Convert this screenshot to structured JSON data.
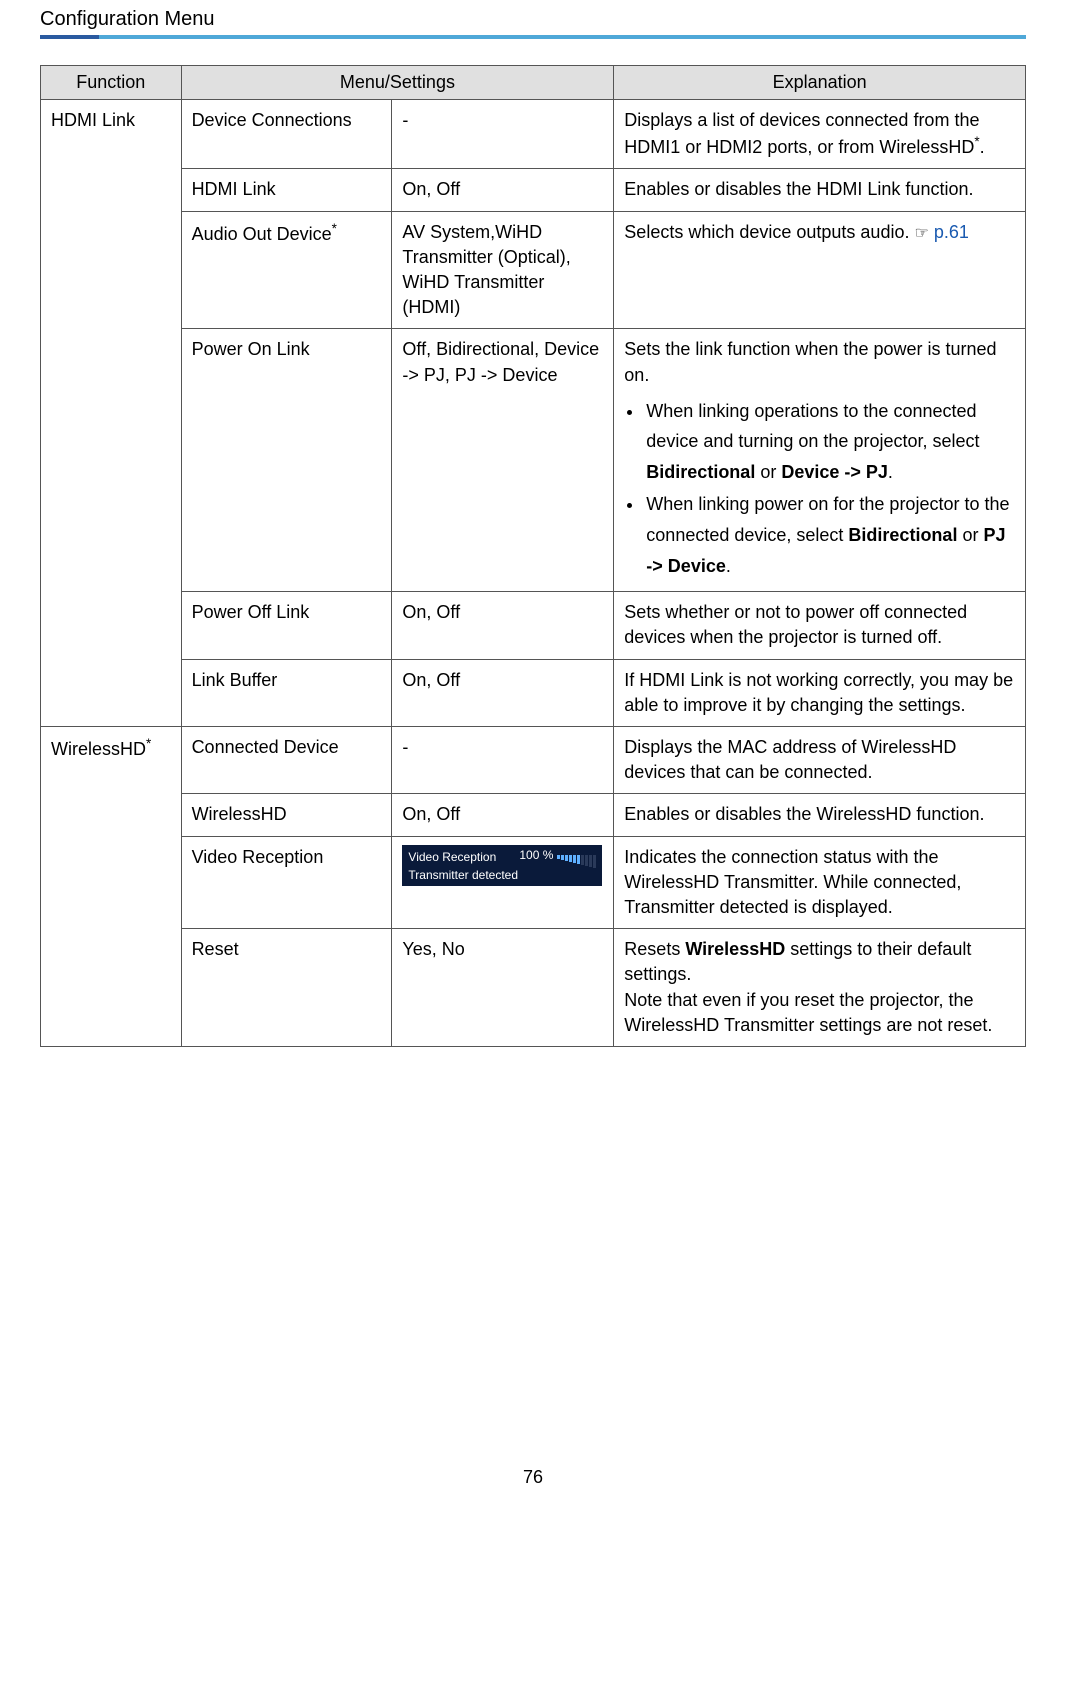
{
  "page_title": "Configuration Menu",
  "page_number": "76",
  "headers": {
    "function": "Function",
    "menu_settings": "Menu/Settings",
    "explanation": "Explanation"
  },
  "groups": [
    {
      "function": "HDMI Link",
      "function_sup": "",
      "rows": [
        {
          "menu": "Device Connections",
          "menu_sup": "",
          "settings": "-",
          "explanation_parts": [
            {
              "t": "text",
              "v": "Displays a list of devices connected from the HDMI1 or HDMI2 ports, or from WirelessHD"
            },
            {
              "t": "sup",
              "v": "*"
            },
            {
              "t": "text",
              "v": "."
            }
          ]
        },
        {
          "menu": "HDMI Link",
          "menu_sup": "",
          "settings": "On, Off",
          "explanation_parts": [
            {
              "t": "text",
              "v": "Enables or disables the HDMI Link function."
            }
          ]
        },
        {
          "menu": "Audio Out Device",
          "menu_sup": "*",
          "settings": "AV System,WiHD Transmitter (Optical), WiHD Transmitter (HDMI)",
          "explanation_parts": [
            {
              "t": "text",
              "v": "Selects which device outputs audio. "
            },
            {
              "t": "pointer",
              "v": "☞"
            },
            {
              "t": "space",
              "v": "  "
            },
            {
              "t": "link",
              "v": "p.61"
            }
          ]
        },
        {
          "menu": "Power On Link",
          "menu_sup": "",
          "settings": "Off, Bidirectional, Device -> PJ, PJ -> Device",
          "explanation_parts": [
            {
              "t": "text",
              "v": "Sets the link function when the power is turned on."
            }
          ],
          "bullets": [
            [
              {
                "t": "text",
                "v": "When linking operations to the connected device and turning on the projector, select "
              },
              {
                "t": "bold",
                "v": "Bidirectional"
              },
              {
                "t": "text",
                "v": " or "
              },
              {
                "t": "bold",
                "v": "Device -> PJ"
              },
              {
                "t": "text",
                "v": "."
              }
            ],
            [
              {
                "t": "text",
                "v": "When linking power on for the projector to the connected device, select "
              },
              {
                "t": "bold",
                "v": "Bidirectional"
              },
              {
                "t": "text",
                "v": " or "
              },
              {
                "t": "bold",
                "v": "PJ -> Device"
              },
              {
                "t": "text",
                "v": "."
              }
            ]
          ]
        },
        {
          "menu": "Power Off Link",
          "menu_sup": "",
          "settings": "On, Off",
          "explanation_parts": [
            {
              "t": "text",
              "v": "Sets whether or not to power off connected devices when the projector is turned off."
            }
          ]
        },
        {
          "menu": "Link Buffer",
          "menu_sup": "",
          "settings": "On, Off",
          "explanation_parts": [
            {
              "t": "text",
              "v": "If HDMI Link is not working correctly, you may be able to improve it by changing the settings."
            }
          ]
        }
      ]
    },
    {
      "function": "WirelessHD",
      "function_sup": "*",
      "rows": [
        {
          "menu": "Connected Device",
          "menu_sup": "",
          "settings": "-",
          "explanation_parts": [
            {
              "t": "text",
              "v": "Displays the MAC address of WirelessHD devices that can be connected."
            }
          ]
        },
        {
          "menu": "WirelessHD",
          "menu_sup": "",
          "settings": "On, Off",
          "explanation_parts": [
            {
              "t": "text",
              "v": "Enables or disables the WirelessHD function."
            }
          ]
        },
        {
          "menu": "Video Reception",
          "menu_sup": "",
          "settings_widget": {
            "line1_label": "Video Reception",
            "percent": "100 %",
            "line2": "Transmitter detected"
          },
          "explanation_parts": [
            {
              "t": "text",
              "v": "Indicates the connection status with the WirelessHD Transmitter. While connected, Transmitter detected is displayed."
            }
          ]
        },
        {
          "menu": "Reset",
          "menu_sup": "",
          "settings": "Yes, No",
          "explanation_parts": [
            {
              "t": "text",
              "v": "Resets "
            },
            {
              "t": "bold",
              "v": "WirelessHD"
            },
            {
              "t": "text",
              "v": " settings to their default settings."
            },
            {
              "t": "br"
            },
            {
              "t": "text",
              "v": "Note that even if you reset the projector, the WirelessHD Transmitter settings are not reset."
            }
          ]
        }
      ]
    }
  ]
}
